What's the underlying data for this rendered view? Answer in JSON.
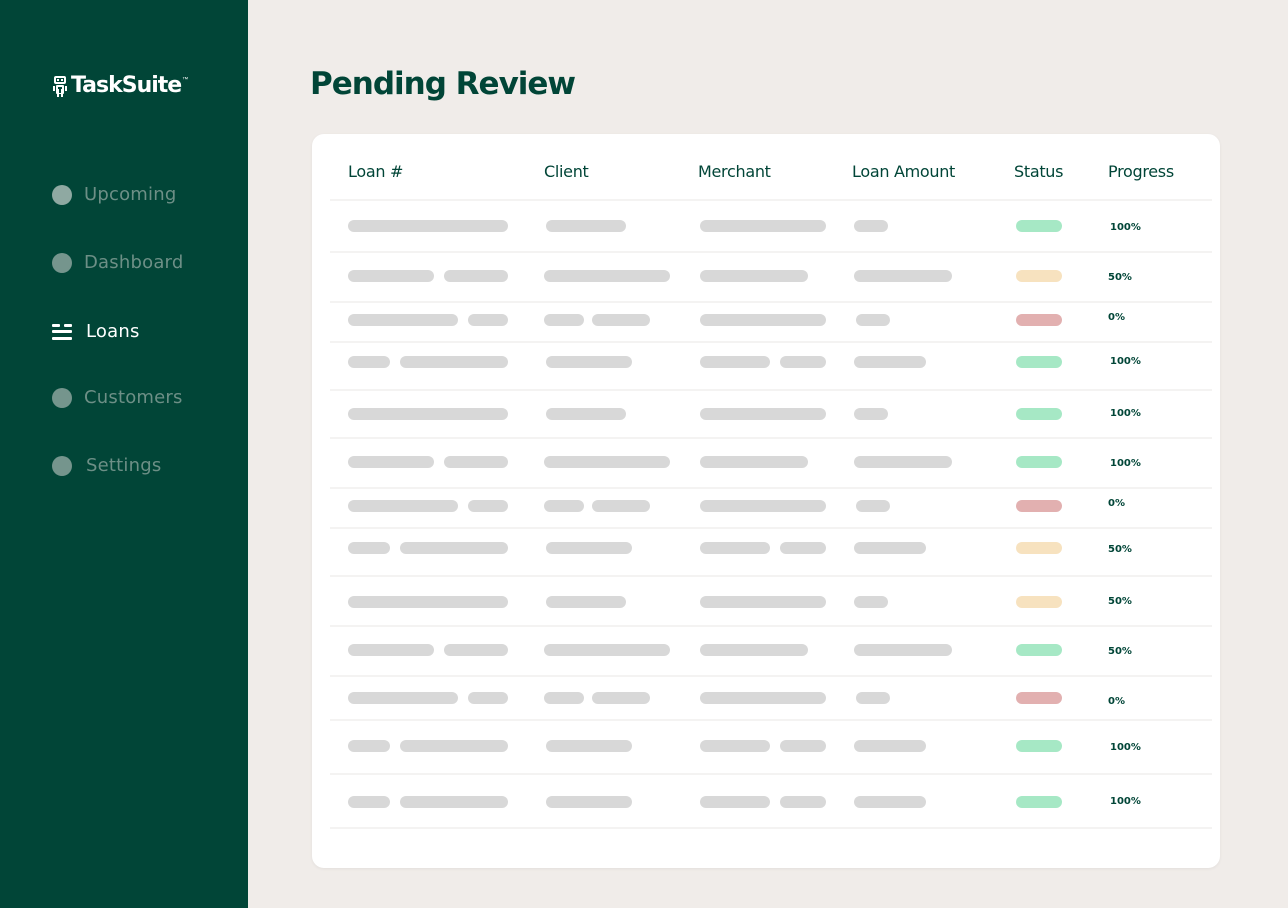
{
  "app": {
    "name": "TaskSuite",
    "trademark": "™",
    "logo_icon": "robot-icon"
  },
  "sidebar": {
    "items": [
      {
        "label": "Upcoming",
        "icon": "circle-icon",
        "active": false
      },
      {
        "label": "Dashboard",
        "icon": "circle-icon",
        "active": false
      },
      {
        "label": "Loans",
        "icon": "list-icon",
        "active": true
      },
      {
        "label": "Customers",
        "icon": "circle-icon",
        "active": false
      },
      {
        "label": "Settings",
        "icon": "circle-icon",
        "active": false
      }
    ]
  },
  "main": {
    "title": "Pending Review",
    "table": {
      "columns": [
        "Loan #",
        "Client",
        "Merchant",
        "Loan Amount",
        "Status",
        "Progress"
      ],
      "rows": [
        {
          "status": "green",
          "progress": "100%"
        },
        {
          "status": "yellow",
          "progress": "50%"
        },
        {
          "status": "red",
          "progress": "0%"
        },
        {
          "status": "green",
          "progress": "100%"
        },
        {
          "status": "green",
          "progress": "100%"
        },
        {
          "status": "green",
          "progress": "100%"
        },
        {
          "status": "red",
          "progress": "0%"
        },
        {
          "status": "yellow",
          "progress": "50%"
        },
        {
          "status": "yellow",
          "progress": "50%"
        },
        {
          "status": "green",
          "progress": "50%"
        },
        {
          "status": "red",
          "progress": "0%"
        },
        {
          "status": "green",
          "progress": "100%"
        },
        {
          "status": "green",
          "progress": "100%"
        }
      ]
    }
  },
  "colors": {
    "sidebar_bg": "#014537",
    "brand_text": "#014537",
    "page_bg": "#f0ece9",
    "status_green": "#a6e8c5",
    "status_yellow": "#f7e2bf",
    "status_red": "#e2b0b0",
    "placeholder": "#d8d8d8"
  }
}
